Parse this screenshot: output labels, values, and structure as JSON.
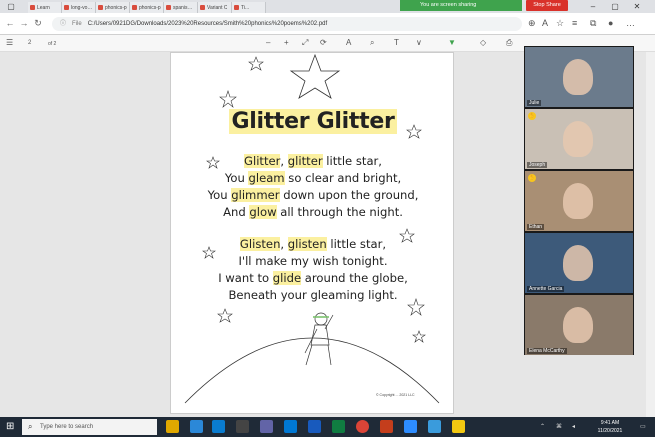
{
  "tabs": [
    {
      "label": "Learn"
    },
    {
      "label": "long-vowel"
    },
    {
      "label": "phonics-p"
    },
    {
      "label": "phonics-p"
    },
    {
      "label": "spanish-m"
    },
    {
      "label": "Variant C"
    },
    {
      "label": "Ti..."
    }
  ],
  "share": {
    "status": "You are screen sharing",
    "stop_label": "Stop Share"
  },
  "address": {
    "file_label": "File",
    "url": "C:/Users/0921DG/Downloads/2023%20Resources/Smith%20phonics%20poems%202.pdf"
  },
  "pdf_toolbar": {
    "page_number": "2",
    "page_total": "of 2"
  },
  "poem": {
    "title": "Glitter Glitter",
    "stanza1": [
      {
        "a": "",
        "h": "Glitter",
        "b": ", ",
        "h2": "glitter",
        "c": " little star,"
      },
      {
        "a": "You ",
        "h": "gleam",
        "b": " so clear and bright,",
        "h2": "",
        "c": ""
      },
      {
        "a": "You ",
        "h": "glimmer",
        "b": " down upon the ground,",
        "h2": "",
        "c": ""
      },
      {
        "a": "And ",
        "h": "glow",
        "b": " all through the night.",
        "h2": "",
        "c": ""
      }
    ],
    "stanza2": [
      {
        "a": "",
        "h": "Glisten",
        "b": ", ",
        "h2": "glisten",
        "c": " little star,"
      },
      {
        "a": "I'll make my wish tonight.",
        "h": "",
        "b": "",
        "h2": "",
        "c": ""
      },
      {
        "a": "I want to ",
        "h": "glide",
        "b": " around the globe,",
        "h2": "",
        "c": ""
      },
      {
        "a": "Beneath your gleaming light.",
        "h": "",
        "b": "",
        "h2": "",
        "c": ""
      }
    ],
    "copyright": "© Copyright ... 2021 LLC"
  },
  "participants": [
    {
      "name": "Julie",
      "hand_raised": false,
      "bg": "#6b7b8c"
    },
    {
      "name": "Joseph",
      "hand_raised": true,
      "bg": "#c9c0b5"
    },
    {
      "name": "Ethan",
      "hand_raised": true,
      "bg": "#a98f74"
    },
    {
      "name": "Annette Garcia",
      "hand_raised": false,
      "bg": "#3d5a7a"
    },
    {
      "name": "Elena McCarthy",
      "hand_raised": false,
      "bg": "#8a7a6a"
    }
  ],
  "taskbar": {
    "search_placeholder": "Type here to search",
    "time": "9:41 AM",
    "date": "11/20/2021"
  },
  "icons": {
    "back": "arrow-left-icon",
    "forward": "arrow-right-icon",
    "reload": "reload-icon",
    "search": "search-icon",
    "start": "windows-start-icon"
  },
  "colors": {
    "share_green": "#3fa34d",
    "stop_red": "#d9312a",
    "highlight": "#fbf0a0",
    "taskbar": "#1f2a37"
  }
}
